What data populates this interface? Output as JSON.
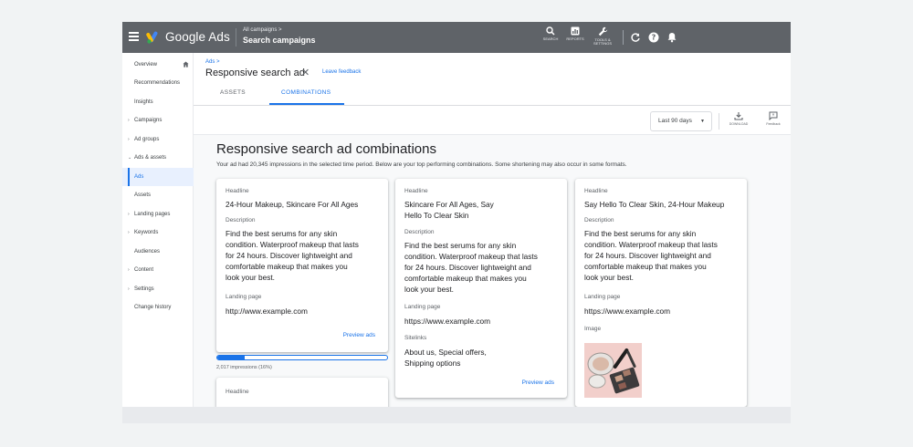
{
  "topbar": {
    "brand": "Google Ads",
    "breadcrumb_small": "All campaigns >",
    "breadcrumb_main": "Search campaigns",
    "tools": [
      {
        "label": "SEARCH"
      },
      {
        "label": "REPORTS"
      },
      {
        "label": "TOOLS & SETTINGS"
      }
    ]
  },
  "sidebar": {
    "items": [
      {
        "label": "Overview"
      },
      {
        "label": "Recommendations"
      },
      {
        "label": "Insights"
      },
      {
        "label": "Campaigns"
      },
      {
        "label": "Ad groups"
      },
      {
        "label": "Ads & assets"
      },
      {
        "label": "Ads"
      },
      {
        "label": "Assets"
      },
      {
        "label": "Landing pages"
      },
      {
        "label": "Keywords"
      },
      {
        "label": "Audiences"
      },
      {
        "label": "Content"
      },
      {
        "label": "Settings"
      },
      {
        "label": "Change history"
      }
    ]
  },
  "header": {
    "crumb": "Ads >",
    "title": "Responsive search ad",
    "leave_feedback": "Leave feedback",
    "tabs": [
      {
        "label": "ASSETS"
      },
      {
        "label": "COMBINATIONS"
      }
    ]
  },
  "toolrow": {
    "date_range": "Last 90 days",
    "download_label": "DOWNLOAD",
    "feedback_label": "Feedback"
  },
  "content": {
    "title": "Responsive search ad combinations",
    "subtitle": "Your ad had 20,345 impressions in the selected time period. Below are your top performing combinations. Some shortening may also occur in some formats.",
    "cards": [
      {
        "headline_label": "Headline",
        "headline": "24-Hour Makeup, Skincare For All Ages",
        "description_label": "Description",
        "description_lines": [
          "Find the best serums for any skin",
          "condition. Waterproof makeup that lasts",
          "for 24 hours. Discover lightweight and",
          "comfortable makeup that makes you",
          "look your best."
        ],
        "landing_label": "Landing page",
        "landing": "http://www.example.com",
        "preview": "Preview ads"
      },
      {
        "headline_label": "Headline",
        "headline_lines": [
          "Skincare For All Ages, Say",
          "Hello To Clear Skin"
        ],
        "description_label": "Description",
        "description_lines": [
          "Find the best serums for any skin",
          "condition. Waterproof makeup that lasts",
          "for 24 hours. Discover lightweight and",
          "comfortable makeup that makes you",
          "look your best."
        ],
        "landing_label": "Landing page",
        "landing": "https://www.example.com",
        "sitelinks_label": "Sitelinks",
        "sitelinks_lines": [
          "About us, Special offers,",
          "Shipping options"
        ],
        "preview": "Preview ads"
      },
      {
        "headline_label": "Headline",
        "headline": "Say Hello To Clear Skin, 24-Hour Makeup",
        "description_label": "Description",
        "description_lines": [
          "Find the best serums for any skin",
          "condition. Waterproof makeup that lasts",
          "for 24 hours. Discover lightweight and",
          "comfortable makeup that makes you",
          "look your best."
        ],
        "landing_label": "Landing page",
        "landing": "https://www.example.com",
        "image_label": "Image"
      }
    ],
    "impressions": {
      "fraction": 0.16,
      "label": "2,017 impressions (16%)"
    },
    "next_card_headline_label": "Headline"
  },
  "colors": {
    "topbar": "#5f6368",
    "accent": "#1a73e8",
    "page_bg": "#f8f9fa"
  }
}
